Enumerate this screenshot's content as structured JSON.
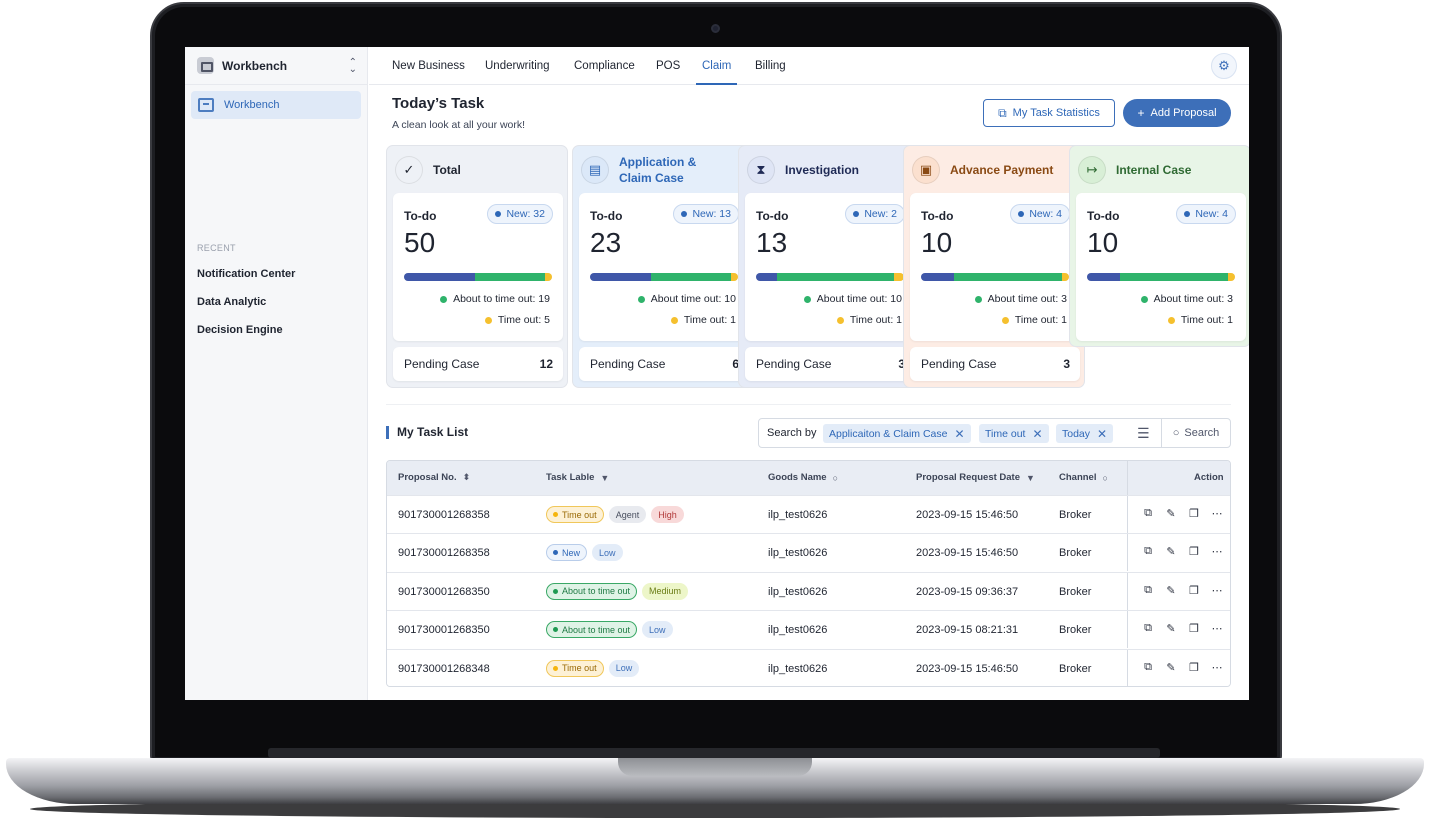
{
  "workspace": {
    "name": "Workbench"
  },
  "sidebar": {
    "active_item": "Workbench",
    "recent_title": "RECENT",
    "recent": [
      "Notification Center",
      "Data Analytic",
      "Decision Engine"
    ]
  },
  "topnav": {
    "tabs": [
      "New Business",
      "Underwriting",
      "Compliance",
      "POS",
      "Claim",
      "Billing"
    ],
    "active_tab": "Claim"
  },
  "header": {
    "title": "Today’s Task",
    "subtitle": "A clean look at all your work!",
    "stats_button": "My Task Statistics",
    "add_button": "Add Proposal"
  },
  "cards": [
    {
      "title": "Total",
      "todo_label": "To-do",
      "new_label": "New: 32",
      "count": "50",
      "about": "About to time out: 19",
      "timeout": "Time out: 5",
      "pending_label": "Pending Case",
      "pending": "12",
      "bar_fraction": [
        0.48,
        0.47,
        0.05
      ]
    },
    {
      "title": "Application & Claim Case",
      "todo_label": "To-do",
      "new_label": "New: 13",
      "count": "23",
      "about": "About time out: 10",
      "timeout": "Time out: 1",
      "pending_label": "Pending Case",
      "pending": "6",
      "bar_fraction": [
        0.41,
        0.54,
        0.05
      ]
    },
    {
      "title": "Investigation",
      "todo_label": "To-do",
      "new_label": "New: 2",
      "count": "13",
      "about": "About time out: 10",
      "timeout": "Time out: 1",
      "pending_label": "Pending Case",
      "pending": "3",
      "bar_fraction": [
        0.14,
        0.79,
        0.07
      ]
    },
    {
      "title": "Advance Payment",
      "todo_label": "To-do",
      "new_label": "New: 4",
      "count": "10",
      "about": "About time out: 3",
      "timeout": "Time out: 1",
      "pending_label": "Pending Case",
      "pending": "3",
      "bar_fraction": [
        0.22,
        0.73,
        0.05
      ]
    },
    {
      "title": "Internal Case",
      "todo_label": "To-do",
      "new_label": "New: 4",
      "count": "10",
      "about": "About time out: 3",
      "timeout": "Time out: 1",
      "bar_fraction": [
        0.22,
        0.73,
        0.05
      ]
    }
  ],
  "colors": {
    "bar_new": "#3f57a8",
    "bar_about": "#2fb36b",
    "bar_timeout": "#f5c02e",
    "accent": "#3d6fb9",
    "card_bg": [
      "#eef1f6",
      "#e4eefa",
      "#e6ebf7",
      "#fdece4",
      "#e8f5e7"
    ],
    "card_title": [
      "#1f2430",
      "#2e67b7",
      "#1f2a55",
      "#8a4a14",
      "#2f6a33"
    ]
  },
  "icons": {
    "card": [
      "check-badge-icon",
      "document-icon",
      "hourglass-icon",
      "clipboard-icon",
      "calendar-arrow-icon"
    ],
    "row_actions": [
      "view-icon",
      "edit-icon",
      "copy-icon",
      "more-icon"
    ]
  },
  "tasklist": {
    "title": "My Task List",
    "search_label": "Search by",
    "chips": [
      "Applicaiton & Claim Case",
      "Time out",
      "Today"
    ],
    "search_button": "Search",
    "columns": [
      "Proposal No.",
      "Task Lable",
      "Goods Name",
      "Proposal Request Date",
      "Channel",
      "Action"
    ],
    "rows": [
      {
        "proposal": "901730001268358",
        "tags": [
          {
            "text": "Time out",
            "kind": "timeout"
          },
          {
            "text": "Agent",
            "kind": "agent"
          },
          {
            "text": "High",
            "kind": "high"
          }
        ],
        "goods": "ilp_test0626",
        "date": "2023-09-15 15:46:50",
        "channel": "Broker"
      },
      {
        "proposal": "901730001268358",
        "tags": [
          {
            "text": "New",
            "kind": "new"
          },
          {
            "text": "Low",
            "kind": "low"
          }
        ],
        "goods": "ilp_test0626",
        "date": "2023-09-15 15:46:50",
        "channel": "Broker"
      },
      {
        "proposal": "901730001268350",
        "tags": [
          {
            "text": "About to time out",
            "kind": "about"
          },
          {
            "text": "Medium",
            "kind": "medium"
          }
        ],
        "goods": "ilp_test0626",
        "date": "2023-09-15 09:36:37",
        "channel": "Broker"
      },
      {
        "proposal": "901730001268350",
        "tags": [
          {
            "text": "About to time out",
            "kind": "about"
          },
          {
            "text": "Low",
            "kind": "low"
          }
        ],
        "goods": "ilp_test0626",
        "date": "2023-09-15 08:21:31",
        "channel": "Broker"
      },
      {
        "proposal": "901730001268348",
        "tags": [
          {
            "text": "Time out",
            "kind": "timeout"
          },
          {
            "text": "Low",
            "kind": "low"
          }
        ],
        "goods": "ilp_test0626",
        "date": "2023-09-15 15:46:50",
        "channel": "Broker"
      }
    ]
  }
}
